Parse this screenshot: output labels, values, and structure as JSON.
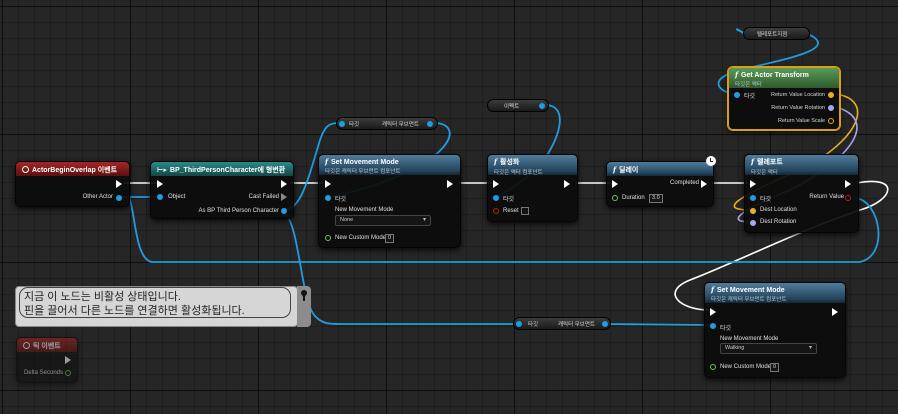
{
  "colors": {
    "wire_object": "#1f9de0",
    "wire_exec": "#ffffff",
    "wire_vector": "#e8b020",
    "wire_rotator": "#a8a8e8",
    "wire_float": "#70c060",
    "selection": "#d8a018"
  },
  "nodes": {
    "begin_overlap": {
      "title": "ActorBeginOverlap 이벤트",
      "other_actor": "Other Actor"
    },
    "cast": {
      "title": "BP_ThirdPersonCharacter에 형변환",
      "object": "Object",
      "cast_failed": "Cast Failed",
      "as_output": "As BP Third Person Character"
    },
    "set_movement_1": {
      "title": "Set Movement Mode",
      "subtitle": "타깃은 캐릭터 무브먼트 컴포넌트",
      "target": "타깃",
      "new_mode_label": "New Movement Mode",
      "new_mode_value": "None",
      "custom_mode_label": "New Custom Mode",
      "custom_mode_value": "0"
    },
    "activate": {
      "title": "활성화",
      "subtitle": "타깃은 액터 컴포넌트",
      "target": "타깃",
      "reset": "Reset"
    },
    "delay": {
      "title": "딜레이",
      "completed": "Completed",
      "duration_label": "Duration",
      "duration_value": "3.0"
    },
    "get_transform": {
      "title": "Get Actor Transform",
      "subtitle": "타깃은 액터",
      "target": "타깃",
      "return_location": "Return Value Location",
      "return_rotation": "Return Value Rotation",
      "return_scale": "Return Value Scale"
    },
    "teleport": {
      "title": "텔레포트",
      "subtitle": "타깃은 액터",
      "target": "타깃",
      "return_value": "Return Value",
      "dest_location": "Dest Location",
      "dest_rotation": "Dest Rotation"
    },
    "set_movement_2": {
      "title": "Set Movement Mode",
      "subtitle": "타깃은 캐릭터 무브먼트 컴포넌트",
      "target": "타깃",
      "new_mode_label": "New Movement Mode",
      "new_mode_value": "Walking",
      "custom_mode_label": "New Custom Mode",
      "custom_mode_value": "0"
    },
    "tick": {
      "title": "틱 이벤트",
      "delta_seconds": "Delta Seconds"
    }
  },
  "reroutes": {
    "char_move_top": {
      "target": "타깃",
      "label": "캐릭터 무브먼트"
    },
    "effect": {
      "label": "이펙트"
    },
    "teleport_target": {
      "label": "텔레포트지점"
    },
    "char_move_bottom": {
      "target": "타깃",
      "label": "캐릭터 무브먼트"
    }
  },
  "tooltip": {
    "line1": "지금 이 노드는 비활성 상태입니다.",
    "line2": "핀을 끌어서 다른 노드를 연결하면 활성화됩니다."
  },
  "icons": {
    "function": "f",
    "dropdown": "▾",
    "pin_tooltip": "pin-icon",
    "delay_clock": "clock-icon"
  }
}
